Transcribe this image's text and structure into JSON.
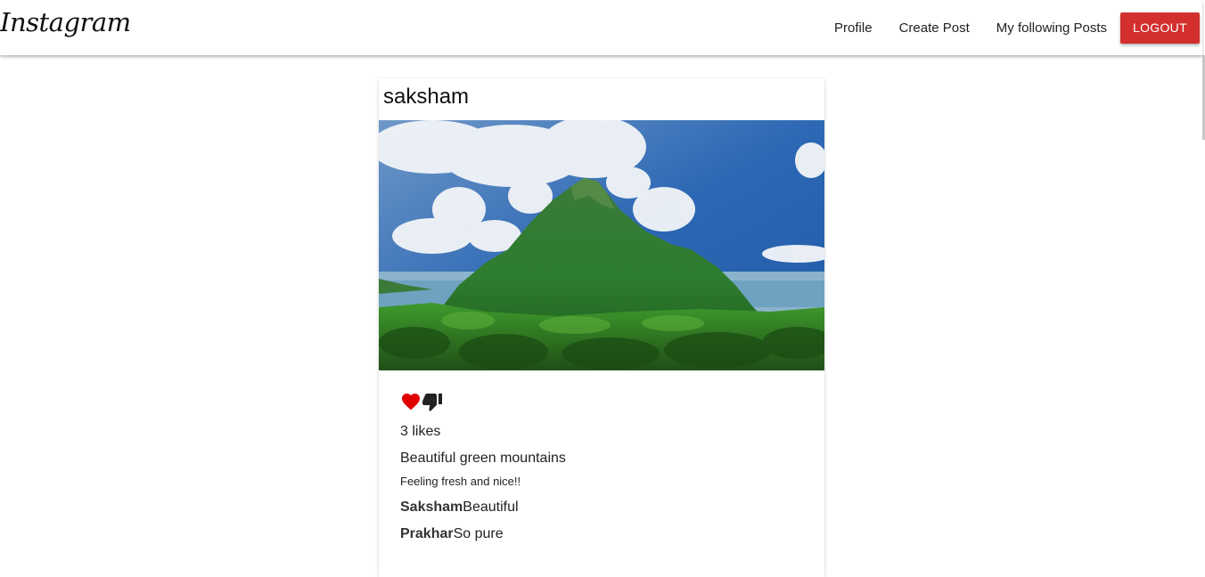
{
  "brand": {
    "name": "Instagram"
  },
  "nav": {
    "links": [
      "Profile",
      "Create Post",
      "My following Posts"
    ],
    "logout_label": "LOGOUT"
  },
  "post": {
    "author": "saksham",
    "image_alt": "Beautiful green mountains",
    "likes_text": "3 likes",
    "title": "Beautiful green mountains",
    "body": "Feeling fresh and nice!!",
    "comments": [
      {
        "user": "Saksham",
        "text": "Beautiful"
      },
      {
        "user": "Prakhar",
        "text": "So pure"
      }
    ]
  },
  "icons": {
    "like": "heart-icon",
    "unlike": "thumbs-down-icon"
  },
  "colors": {
    "logout_button": "#d32f2f",
    "heart": "#e00000",
    "thumb": "#222222"
  }
}
